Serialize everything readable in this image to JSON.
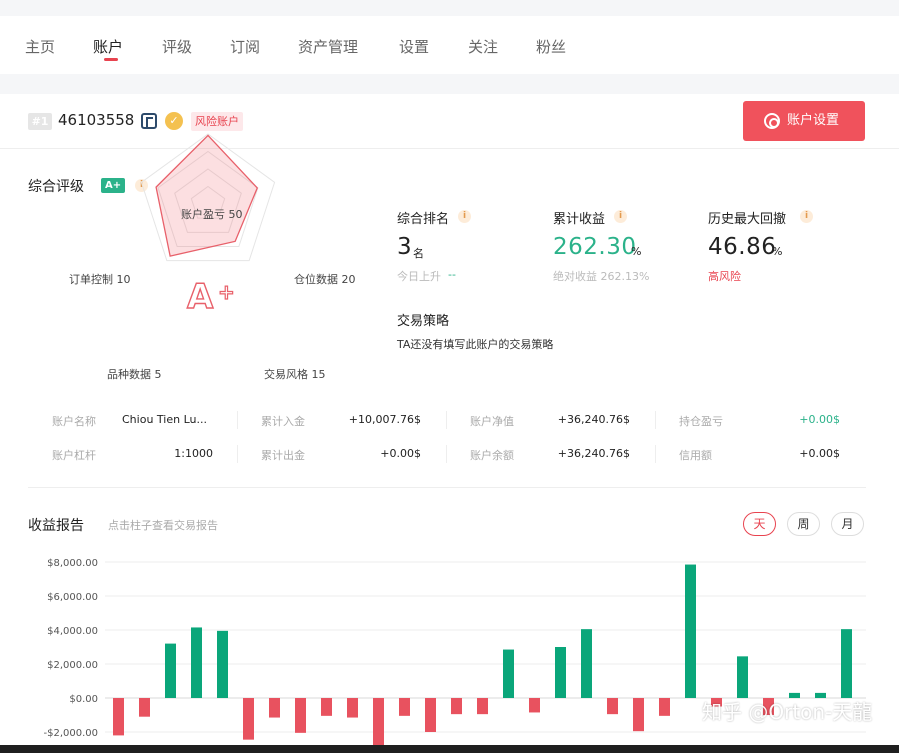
{
  "nav": {
    "items": [
      "主页",
      "账户",
      "评级",
      "订阅",
      "资产管理",
      "设置",
      "关注",
      "粉丝"
    ],
    "active_index": 1
  },
  "header": {
    "rank_badge": "#1",
    "account_id": "46103558",
    "risk_tag": "风险账户",
    "settings_button": "账户设置"
  },
  "rating": {
    "title": "综合评级",
    "grade": "A+",
    "radar": [
      {
        "label": "账户盈亏 50",
        "value": 50
      },
      {
        "label": "仓位数据 20",
        "value": 20
      },
      {
        "label": "交易风格 15",
        "value": 15
      },
      {
        "label": "品种数据 5",
        "value": 5
      },
      {
        "label": "订单控制 10",
        "value": 10
      }
    ],
    "radar_max": 50
  },
  "stats": {
    "rank": {
      "title": "综合排名",
      "value": "3",
      "unit": "名",
      "sub_label": "今日上升",
      "sub_value": "--"
    },
    "return": {
      "title": "累计收益",
      "value": "262.30",
      "unit": "%",
      "sub": "绝对收益 262.13%"
    },
    "drawdown": {
      "title": "历史最大回撤",
      "value": "46.86",
      "unit": "%",
      "sub": "高风险"
    }
  },
  "strategy": {
    "title": "交易策略",
    "text": "TA还没有填写此账户的交易策略"
  },
  "account_info": {
    "name_label": "账户名称",
    "name": "Chiou Tien Lu...",
    "leverage_label": "账户杠杆",
    "leverage": "1:1000",
    "deposit_label": "累计入金",
    "deposit": "+10,007.76$",
    "withdraw_label": "累计出金",
    "withdraw": "+0.00$",
    "equity_label": "账户净值",
    "equity": "+36,240.76$",
    "balance_label": "账户余额",
    "balance": "+36,240.76$",
    "float_label": "持仓盈亏",
    "float_pl": "+0.00$",
    "credit_label": "信用额",
    "credit": "+0.00$"
  },
  "report": {
    "title": "收益报告",
    "hint": "点击柱子查看交易报告",
    "periods": [
      "天",
      "周",
      "月"
    ],
    "active_period": 0
  },
  "colors": {
    "accent_red": "#e8434f",
    "positive_green": "#0aa67a",
    "negative_red": "#e8525f"
  },
  "chart_data": {
    "type": "bar",
    "ylim": [
      -2000,
      8000
    ],
    "yticks": [
      "$8,000.00",
      "$6,000.00",
      "$4,000.00",
      "$2,000.00",
      "$0.00",
      "-$2,000.00"
    ],
    "ytick_values": [
      8000,
      6000,
      4000,
      2000,
      0,
      -2000
    ],
    "values": [
      -2200,
      -1100,
      3200,
      4150,
      3950,
      -2450,
      -1150,
      -2050,
      -1050,
      -1150,
      -3100,
      -1050,
      -2000,
      -950,
      -950,
      2850,
      -850,
      3000,
      4050,
      -950,
      -1950,
      -1050,
      7850,
      -500,
      2450,
      -1000,
      300,
      300,
      4050
    ]
  },
  "watermark": "知乎 @Orton-天龍"
}
